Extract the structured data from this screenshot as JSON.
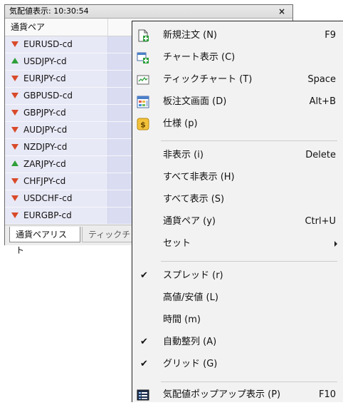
{
  "market_watch": {
    "title": "気配値表示: 10:30:54",
    "close_glyph": "×",
    "header": "通貨ペア",
    "rows": [
      {
        "symbol": "EURUSD-cd",
        "direction": "down"
      },
      {
        "symbol": "USDJPY-cd",
        "direction": "up"
      },
      {
        "symbol": "EURJPY-cd",
        "direction": "down"
      },
      {
        "symbol": "GBPUSD-cd",
        "direction": "down"
      },
      {
        "symbol": "GBPJPY-cd",
        "direction": "down"
      },
      {
        "symbol": "AUDJPY-cd",
        "direction": "down"
      },
      {
        "symbol": "NZDJPY-cd",
        "direction": "down"
      },
      {
        "symbol": "ZARJPY-cd",
        "direction": "up"
      },
      {
        "symbol": "CHFJPY-cd",
        "direction": "down"
      },
      {
        "symbol": "USDCHF-cd",
        "direction": "down"
      },
      {
        "symbol": "EURGBP-cd",
        "direction": "down"
      }
    ],
    "tabs": {
      "active": "通貨ペアリスト",
      "inactive": "ティックチャート"
    },
    "colors": {
      "up": "#2f9f3a",
      "down": "#d84a2a",
      "row_bg": "#e8e9f6"
    }
  },
  "context_menu": {
    "items": [
      {
        "label": "新規注文 (N)",
        "shortcut": "F9",
        "icon": "new-order-icon"
      },
      {
        "label": "チャート表示 (C)",
        "shortcut": "",
        "icon": "chart-window-icon"
      },
      {
        "label": "ティックチャート (T)",
        "shortcut": "Space",
        "icon": "tick-chart-icon"
      },
      {
        "label": "板注文画面 (D)",
        "shortcut": "Alt+B",
        "icon": "depth-of-market-icon"
      },
      {
        "label": "仕様 (p)",
        "shortcut": "",
        "icon": "specification-icon"
      },
      {
        "label": "非表示 (i)",
        "shortcut": "Delete"
      },
      {
        "label": "すべて非表示 (H)",
        "shortcut": ""
      },
      {
        "label": "すべて表示 (S)",
        "shortcut": ""
      },
      {
        "label": "通貨ペア (y)",
        "shortcut": "Ctrl+U"
      },
      {
        "label": "セット",
        "shortcut": "",
        "submenu": true
      },
      {
        "label": "スプレッド (r)",
        "shortcut": "",
        "checked": true
      },
      {
        "label": "高値/安値 (L)",
        "shortcut": ""
      },
      {
        "label": "時間 (m)",
        "shortcut": ""
      },
      {
        "label": "自動整列 (A)",
        "shortcut": "",
        "checked": true
      },
      {
        "label": "グリッド (G)",
        "shortcut": "",
        "checked": true
      },
      {
        "label": "気配値ポップアップ表示 (P)",
        "shortcut": "F10",
        "icon": "popup-prices-icon"
      }
    ],
    "check_glyph": "✔"
  }
}
